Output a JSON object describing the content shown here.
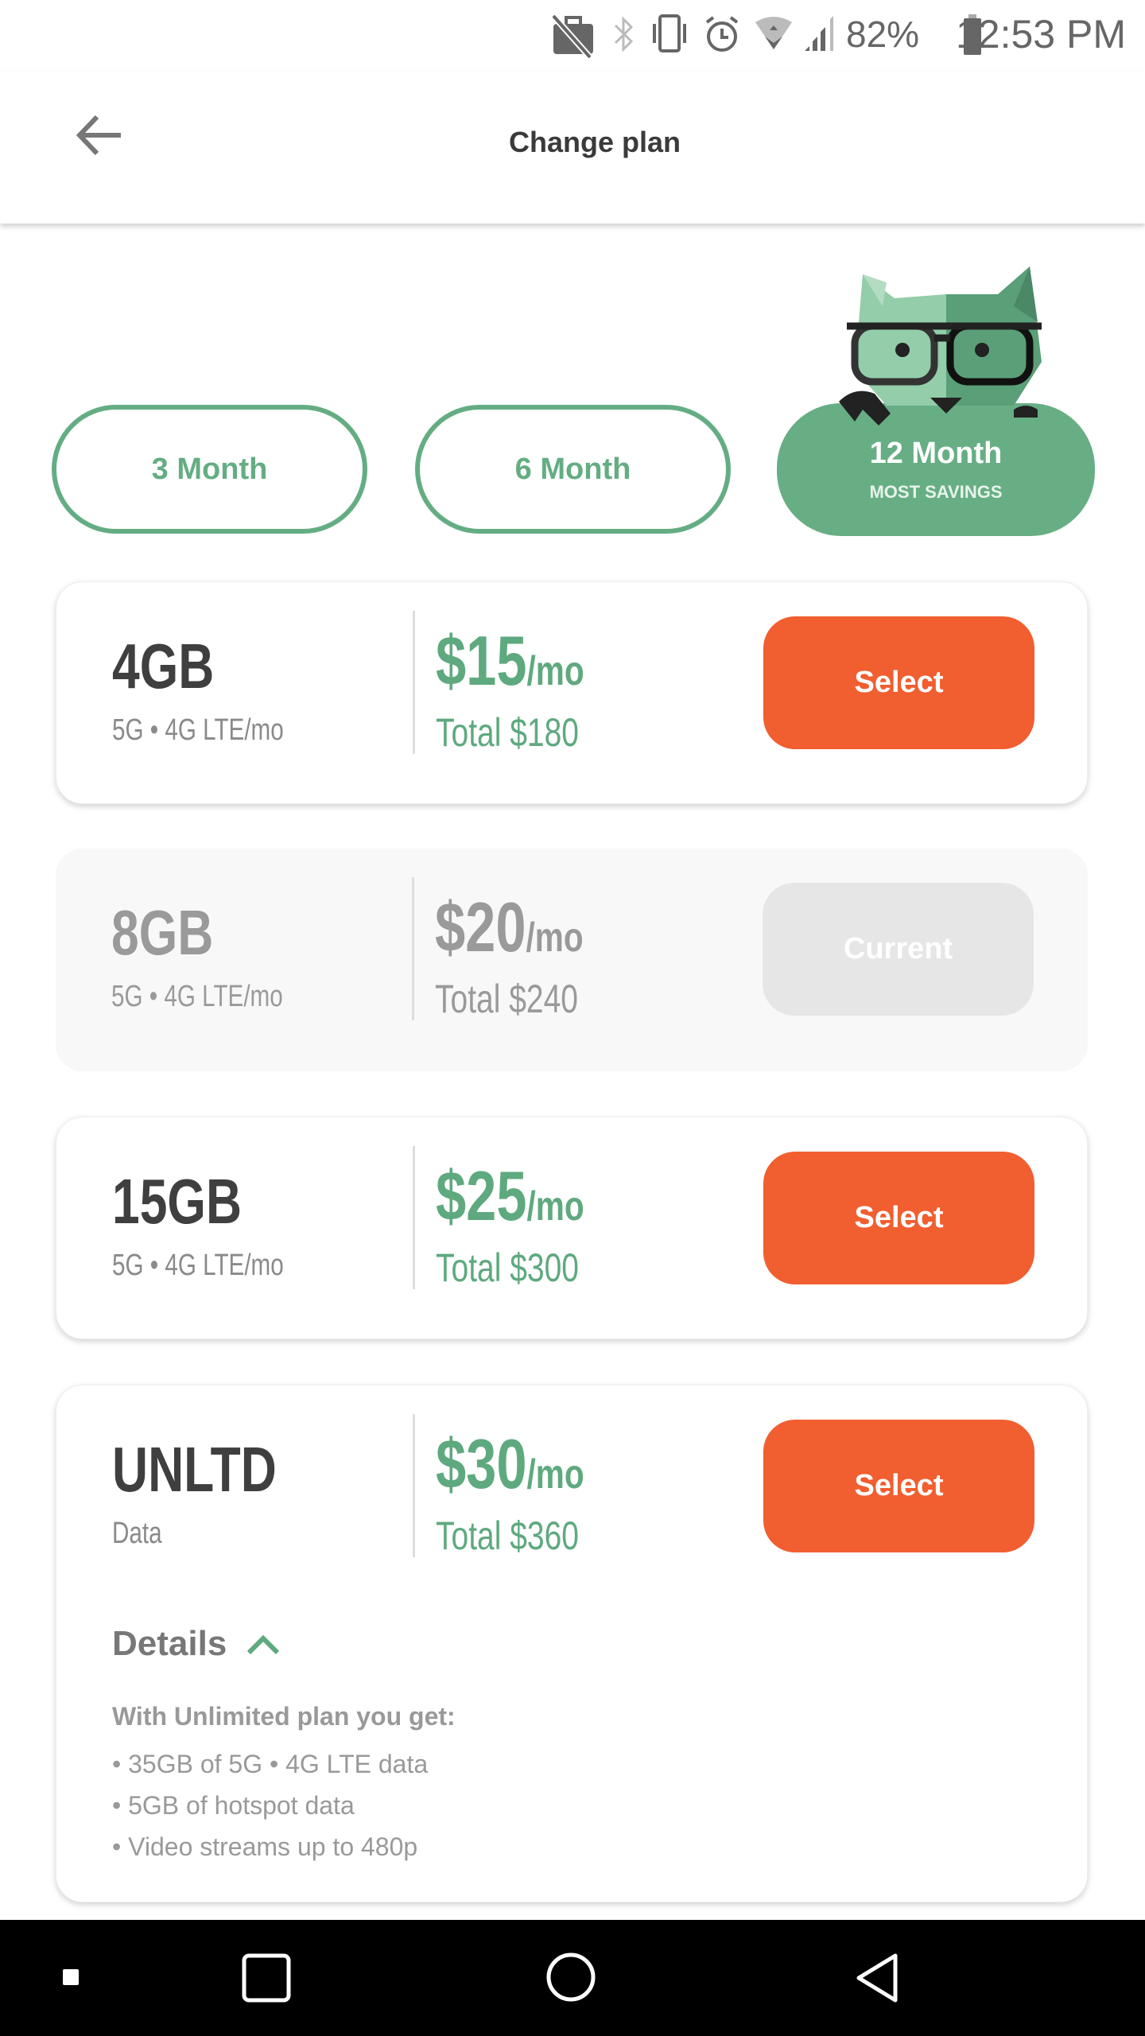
{
  "status_bar": {
    "battery": "82%",
    "time": "12:53 PM",
    "icons": [
      "work-off-icon",
      "bluetooth-icon",
      "vibrate-icon",
      "alarm-icon",
      "wifi-icon",
      "signal-icon",
      "battery-icon"
    ]
  },
  "header": {
    "title": "Change plan",
    "back_icon": "arrow-left-icon"
  },
  "terms": [
    {
      "label": "3 Month"
    },
    {
      "label": "6 Month"
    },
    {
      "label": "12 Month",
      "sub": "MOST SAVINGS",
      "selected": true
    }
  ],
  "plans": [
    {
      "name": "4GB",
      "desc": "5G • 4G LTE/mo",
      "price": "$15",
      "unit": "/mo",
      "total": "Total $180",
      "button": "Select",
      "current": false
    },
    {
      "name": "8GB",
      "desc": "5G • 4G LTE/mo",
      "price": "$20",
      "unit": "/mo",
      "total": "Total $240",
      "button": "Current",
      "current": true
    },
    {
      "name": "15GB",
      "desc": "5G • 4G LTE/mo",
      "price": "$25",
      "unit": "/mo",
      "total": "Total $300",
      "button": "Select",
      "current": false
    },
    {
      "name": "UNLTD",
      "desc": "Data",
      "price": "$30",
      "unit": "/mo",
      "total": "Total $360",
      "button": "Select",
      "current": false,
      "details": {
        "label": "Details",
        "heading": "With Unlimited plan you get:",
        "items": [
          "• 35GB of 5G • 4G LTE data",
          "• 5GB of hotspot data",
          "• Video streams up to 480p"
        ]
      }
    }
  ],
  "colors": {
    "accent_green": "#67ae84",
    "select_orange": "#f15e30",
    "current_gray": "#e6e6e6"
  }
}
